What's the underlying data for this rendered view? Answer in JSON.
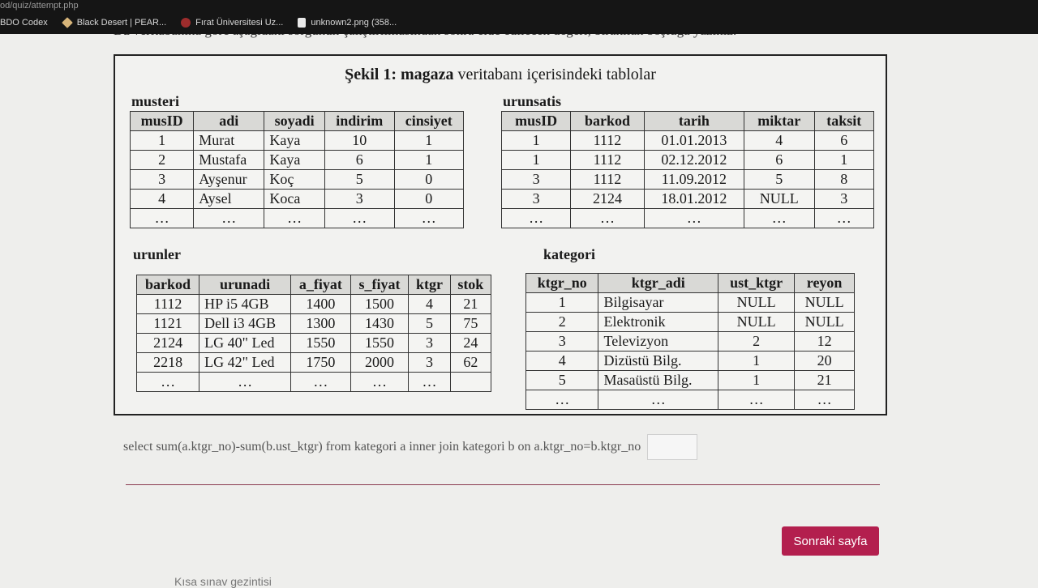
{
  "browser": {
    "url": "od/quiz/attempt.php",
    "bookmarks": [
      {
        "label": "BDO Codex",
        "icon": "bookmark-icon"
      },
      {
        "label": "Black Desert | PEAR...",
        "icon": "diamond-icon"
      },
      {
        "label": "Fırat Üniversitesi Uz...",
        "icon": "university-seal-icon"
      },
      {
        "label": "unknown2.png (358...",
        "icon": "file-icon"
      }
    ]
  },
  "question": {
    "instruction_partial": "Bu veritabanına göre aşağıdaki sorgunun çalıştırılmasından sonra elde edilecek değeri, bırakılan boşluğa yazınız.",
    "figure_title_bold": "Şekil 1: magaza",
    "figure_title_rest": " veritabanı içerisindeki tablolar",
    "query": "select sum(a.ktgr_no)-sum(b.ust_ktgr) from kategori a inner join kategori b on a.ktgr_no=b.ktgr_no",
    "answer_value": ""
  },
  "tables": {
    "musteri": {
      "name": "musteri",
      "headers": [
        "musID",
        "adi",
        "soyadi",
        "indirim",
        "cinsiyet"
      ],
      "rows": [
        [
          "1",
          "Murat",
          "Kaya",
          "10",
          "1"
        ],
        [
          "2",
          "Mustafa",
          "Kaya",
          "6",
          "1"
        ],
        [
          "3",
          "Ayşenur",
          "Koç",
          "5",
          "0"
        ],
        [
          "4",
          "Aysel",
          "Koca",
          "3",
          "0"
        ],
        [
          "…",
          "…",
          "…",
          "…",
          "…"
        ]
      ]
    },
    "urunsatis": {
      "name": "urunsatis",
      "headers": [
        "musID",
        "barkod",
        "tarih",
        "miktar",
        "taksit"
      ],
      "rows": [
        [
          "1",
          "1112",
          "01.01.2013",
          "4",
          "6"
        ],
        [
          "1",
          "1112",
          "02.12.2012",
          "6",
          "1"
        ],
        [
          "3",
          "1112",
          "11.09.2012",
          "5",
          "8"
        ],
        [
          "3",
          "2124",
          "18.01.2012",
          "NULL",
          "3"
        ],
        [
          "…",
          "…",
          "…",
          "…",
          "…"
        ]
      ]
    },
    "urunler": {
      "name": "urunler",
      "headers": [
        "barkod",
        "urunadi",
        "a_fiyat",
        "s_fiyat",
        "ktgr",
        "stok"
      ],
      "rows": [
        [
          "1112",
          "HP i5 4GB",
          "1400",
          "1500",
          "4",
          "21"
        ],
        [
          "1121",
          "Dell i3 4GB",
          "1300",
          "1430",
          "5",
          "75"
        ],
        [
          "2124",
          "LG 40\" Led",
          "1550",
          "1550",
          "3",
          "24"
        ],
        [
          "2218",
          "LG 42\" Led",
          "1750",
          "2000",
          "3",
          "62"
        ],
        [
          "…",
          "…",
          "…",
          "…",
          "…",
          ""
        ]
      ]
    },
    "kategori": {
      "name": "kategori",
      "headers": [
        "ktgr_no",
        "ktgr_adi",
        "ust_ktgr",
        "reyon"
      ],
      "rows": [
        [
          "1",
          "Bilgisayar",
          "NULL",
          "NULL"
        ],
        [
          "2",
          "Elektronik",
          "NULL",
          "NULL"
        ],
        [
          "3",
          "Televizyon",
          "2",
          "12"
        ],
        [
          "4",
          "Dizüstü Bilg.",
          "1",
          "20"
        ],
        [
          "5",
          "Masaüstü Bilg.",
          "1",
          "21"
        ],
        [
          "…",
          "…",
          "…",
          "…"
        ]
      ]
    }
  },
  "navigation": {
    "next_label": "Sonraki sayfa"
  },
  "footer": {
    "partial_text": "Kısa sınav gezintisi"
  },
  "colors": {
    "accent": "#b31f4e",
    "divider": "#8a3a4f"
  }
}
